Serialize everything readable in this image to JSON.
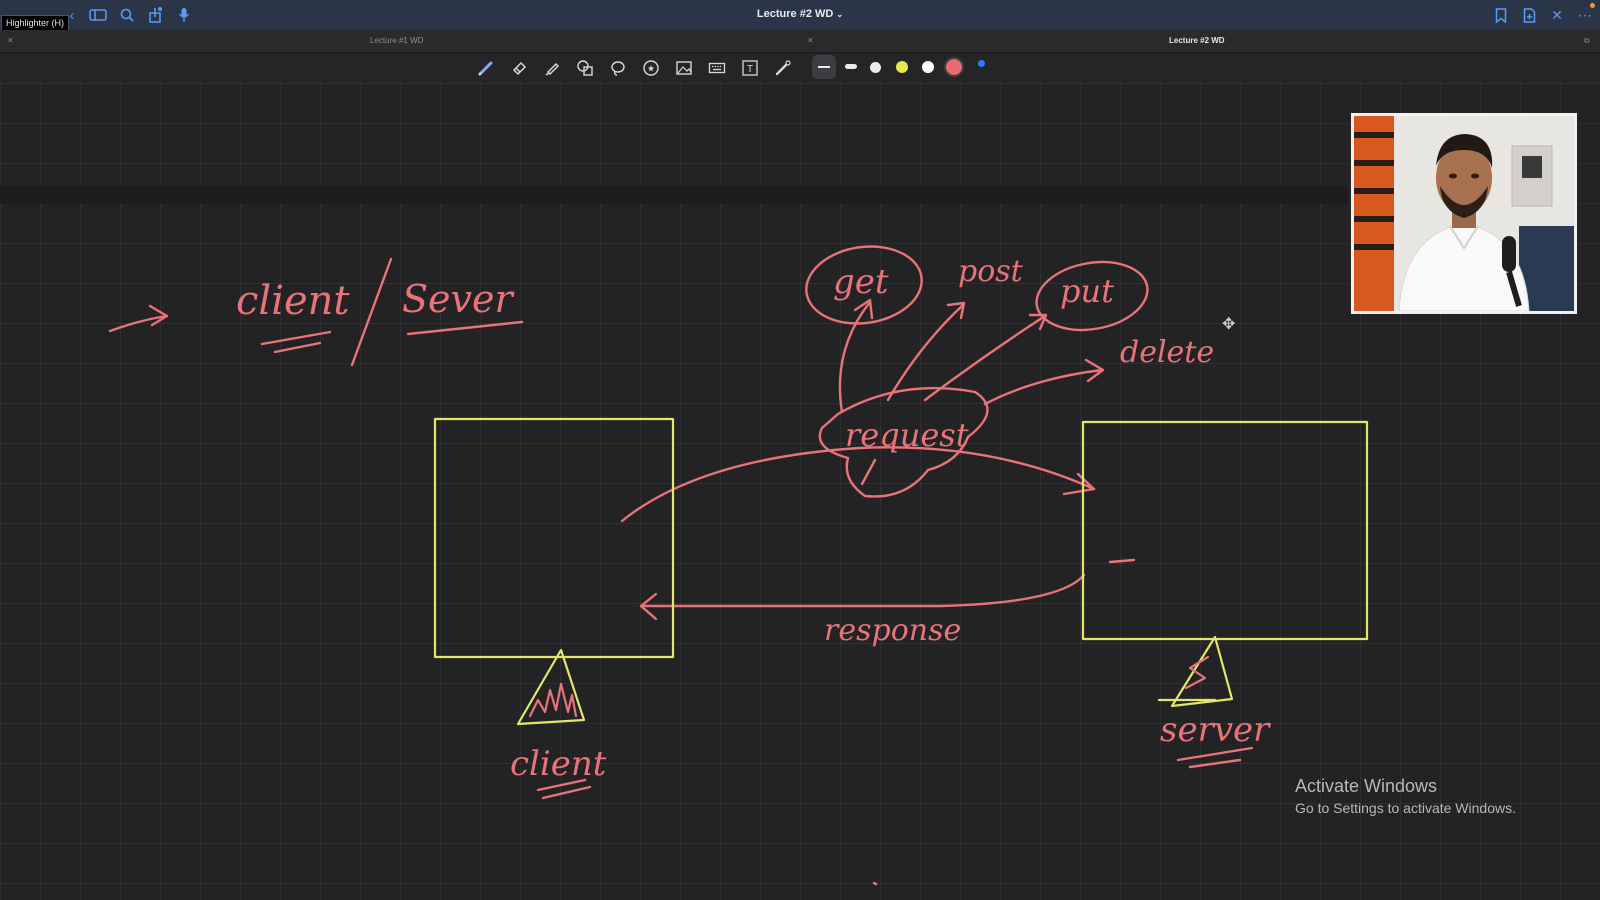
{
  "window": {
    "title": "Lecture #2 WD",
    "tooltip": "Highlighter (H)"
  },
  "tabs": [
    {
      "label": "Lecture #1 WD",
      "active": false
    },
    {
      "label": "Lecture #2 WD",
      "active": true
    }
  ],
  "toolbar": {
    "tools": [
      "pen-icon",
      "eraser-icon",
      "highlighter-icon",
      "shapes-icon",
      "lasso-icon",
      "sticker-icon",
      "image-icon",
      "keyboard-icon",
      "text-icon",
      "laser-pointer-icon"
    ],
    "stroke_widths": [
      "thin",
      "medium",
      "thick"
    ],
    "colors": [
      "#e8e84a",
      "#ffffff",
      "#e96a6e",
      "#2f7cf6"
    ],
    "accent": "#5b9bf5"
  },
  "notes": {
    "heading_client": "client",
    "heading_server": "Sever",
    "get": "get",
    "post": "post",
    "put": "put",
    "delete": "delete",
    "request": "request",
    "response": "response",
    "client_label": "client",
    "server_label": "server",
    "ink_color": "#e8747a",
    "box_color": "#e4e56b"
  },
  "system": {
    "activate_title": "Activate Windows",
    "activate_sub": "Go to Settings to activate Windows."
  }
}
